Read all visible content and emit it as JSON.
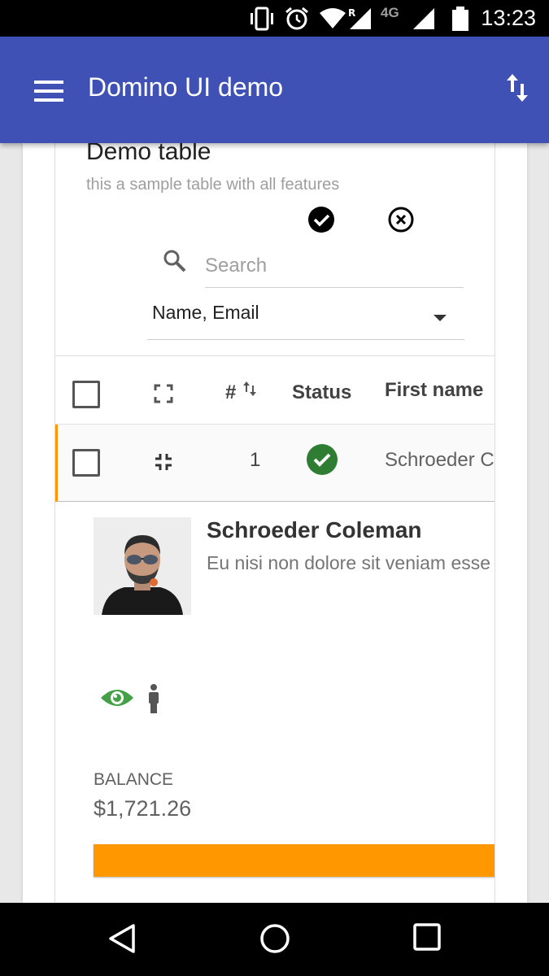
{
  "status_bar": {
    "time": "13:23",
    "network": "4G",
    "icons": [
      "vibrate-icon",
      "alarm-icon",
      "wifi-icon",
      "signal-roaming-icon",
      "signal-icon",
      "battery-icon"
    ]
  },
  "app_bar": {
    "title": "Domino UI demo",
    "background": "#3f51b5",
    "icons": [
      "menu-icon",
      "sort-icon"
    ]
  },
  "card": {
    "title": "Demo table",
    "subtitle": "this a sample table with all features",
    "header_buttons": [
      "check-circle-icon",
      "cancel-circle-icon"
    ],
    "search": {
      "placeholder": "Search",
      "value": ""
    },
    "filter_select": {
      "selected": "Name, Email"
    }
  },
  "table": {
    "columns": [
      {
        "label": ""
      },
      {
        "label": ""
      },
      {
        "label": "#"
      },
      {
        "label": "Status"
      },
      {
        "label": "First name"
      }
    ],
    "rows": [
      {
        "number": "1",
        "status": "active",
        "first_name": "Schroeder Coleman"
      }
    ],
    "row_highlight_color": "#ff9800"
  },
  "details": {
    "name": "Schroeder Coleman",
    "description": "Eu nisi non dolore sit veniam esse",
    "icons": [
      "eye-icon",
      "person-icon"
    ],
    "eye_color": "#43a047",
    "balance_label": "BALANCE",
    "balance_value": "$1,721.26",
    "bar_color": "#ff9800"
  },
  "nav_bar": {
    "icons": [
      "back-icon",
      "home-icon",
      "recents-icon"
    ]
  }
}
